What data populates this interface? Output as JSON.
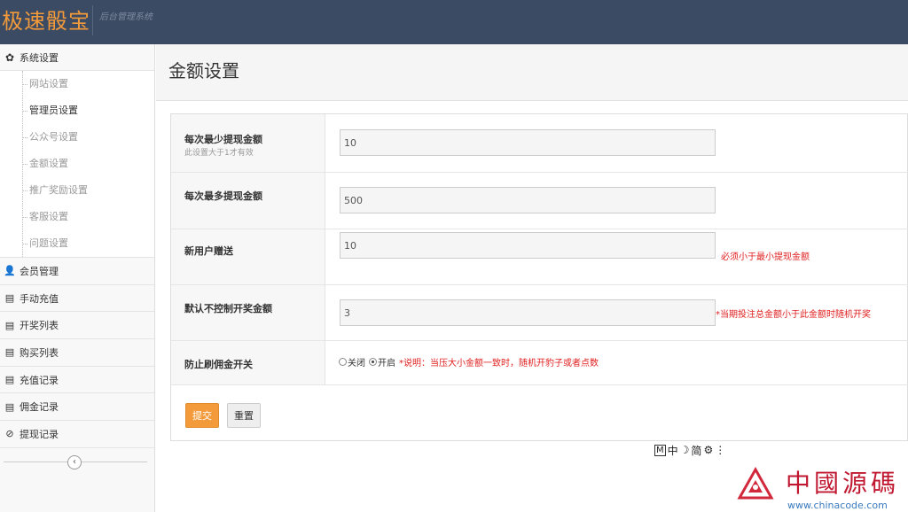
{
  "brand": {
    "title": "极速骰宝",
    "subtitle": "后台管理系统"
  },
  "sidebar": {
    "section": {
      "icon": "gear-icon",
      "label": "系统设置"
    },
    "sub_items": [
      {
        "label": "网站设置",
        "active": false
      },
      {
        "label": "管理员设置",
        "active": true
      },
      {
        "label": "公众号设置",
        "active": false
      },
      {
        "label": "金额设置",
        "active": false
      },
      {
        "label": "推广奖励设置",
        "active": false
      },
      {
        "label": "客服设置",
        "active": false
      },
      {
        "label": "问题设置",
        "active": false
      }
    ],
    "items": [
      {
        "icon": "user-icon",
        "label": "会员管理"
      },
      {
        "icon": "list-icon",
        "label": "手动充值"
      },
      {
        "icon": "list-icon",
        "label": "开奖列表"
      },
      {
        "icon": "list-icon",
        "label": "购买列表"
      },
      {
        "icon": "list-icon",
        "label": "充值记录"
      },
      {
        "icon": "list-icon",
        "label": "佣金记录"
      },
      {
        "icon": "ban-icon",
        "label": "提现记录"
      }
    ],
    "collapse_icon": "chevron-left-icon"
  },
  "page": {
    "title": "金额设置"
  },
  "form": {
    "min_withdraw": {
      "label": "每次最少提现金额",
      "hint": "此设置大于1才有效",
      "value": "10"
    },
    "max_withdraw": {
      "label": "每次最多提现金额",
      "value": "500"
    },
    "new_user_gift": {
      "label": "新用户赠送",
      "value": "10",
      "note": "必须小于最小提现金额"
    },
    "default_uncontrolled": {
      "label": "默认不控制开奖金额",
      "value": "3",
      "note": "*当期投注总金额小于此金额时随机开奖"
    },
    "anti_commission": {
      "label": "防止刷佣金开关",
      "option_off": "关闭",
      "option_on": "开启",
      "selected": "开启",
      "note": "*说明：当压大小金额一致时，随机开豹子或者点数"
    },
    "submit_label": "提交",
    "reset_label": "重置"
  },
  "ime": {
    "m": "M",
    "lang": "中",
    "moon": "☽",
    "simp": "简",
    "gear": "⚙",
    "more": "⋮"
  },
  "watermark": {
    "text": "中國源碼",
    "url": "www.chinacode.com"
  }
}
